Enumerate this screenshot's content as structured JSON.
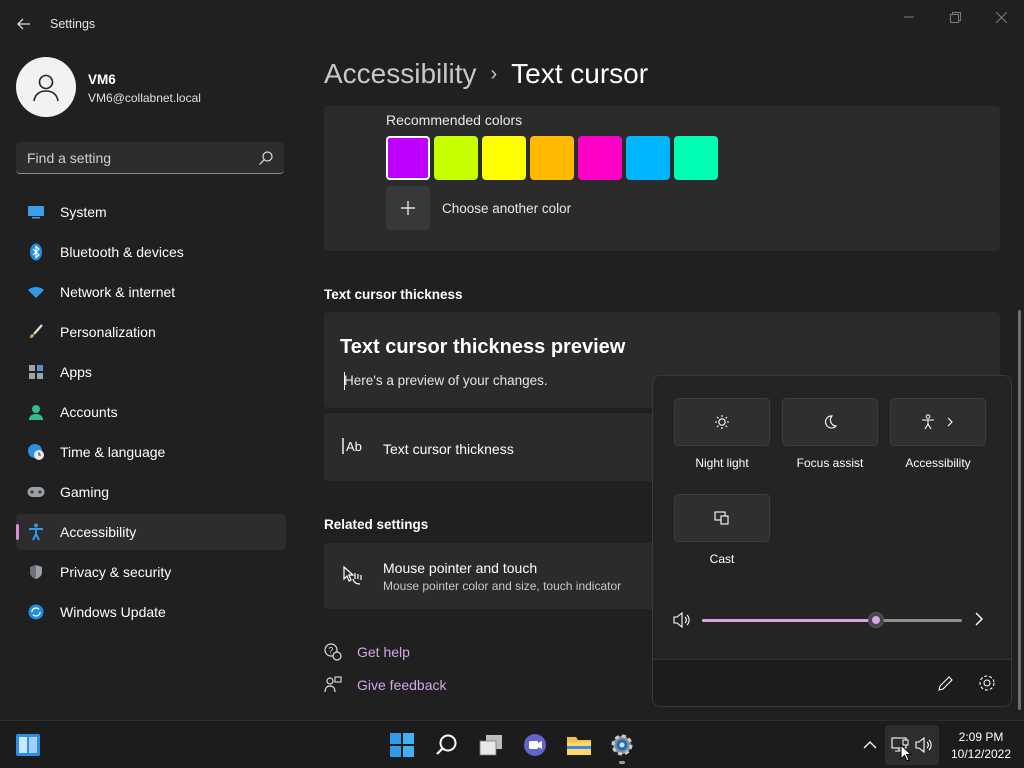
{
  "window": {
    "app_title": "Settings"
  },
  "profile": {
    "name": "VM6",
    "email": "VM6@collabnet.local"
  },
  "search": {
    "placeholder": "Find a setting"
  },
  "sidebar": {
    "items": [
      {
        "label": "System",
        "icon": "system-icon"
      },
      {
        "label": "Bluetooth & devices",
        "icon": "bluetooth-icon"
      },
      {
        "label": "Network & internet",
        "icon": "wifi-icon"
      },
      {
        "label": "Personalization",
        "icon": "brush-icon"
      },
      {
        "label": "Apps",
        "icon": "apps-icon"
      },
      {
        "label": "Accounts",
        "icon": "accounts-icon"
      },
      {
        "label": "Time & language",
        "icon": "globe-clock-icon"
      },
      {
        "label": "Gaming",
        "icon": "gamepad-icon"
      },
      {
        "label": "Accessibility",
        "icon": "accessibility-icon",
        "active": true
      },
      {
        "label": "Privacy & security",
        "icon": "shield-icon"
      },
      {
        "label": "Windows Update",
        "icon": "update-icon"
      }
    ]
  },
  "breadcrumb": {
    "parent": "Accessibility",
    "separator": "›",
    "current": "Text cursor"
  },
  "recommended_colors": {
    "label": "Recommended colors",
    "swatches": [
      "#bf00ff",
      "#c6ff00",
      "#ffff00",
      "#ffb900",
      "#ff00c8",
      "#00b7ff",
      "#00ffb4"
    ],
    "selected_index": 0,
    "add_label": "Choose another color"
  },
  "thickness": {
    "section_title": "Text cursor thickness",
    "preview_title": "Text cursor thickness preview",
    "preview_text": "Here's a preview of your changes.",
    "setting_label": "Text cursor thickness"
  },
  "related": {
    "section_title": "Related settings",
    "mouse_title": "Mouse pointer and touch",
    "mouse_subtitle": "Mouse pointer color and size, touch indicator"
  },
  "help": {
    "get_help": "Get help",
    "give_feedback": "Give feedback"
  },
  "quick_settings": {
    "tiles": [
      {
        "label": "Night light",
        "icon": "brightness-icon"
      },
      {
        "label": "Focus assist",
        "icon": "moon-icon"
      },
      {
        "label": "Accessibility",
        "icon": "accessibility-icon",
        "has_chevron": true
      },
      {
        "label": "Cast",
        "icon": "cast-icon"
      }
    ],
    "volume_fraction": 0.67,
    "accent": "#d7a6e8"
  },
  "taskbar": {
    "time": "2:09 PM",
    "date": "10/12/2022"
  },
  "colors": {
    "background": "#202020",
    "card": "#2b2b2b",
    "accent": "#d7a6e8",
    "accent_indicator": "#d98cd9"
  }
}
